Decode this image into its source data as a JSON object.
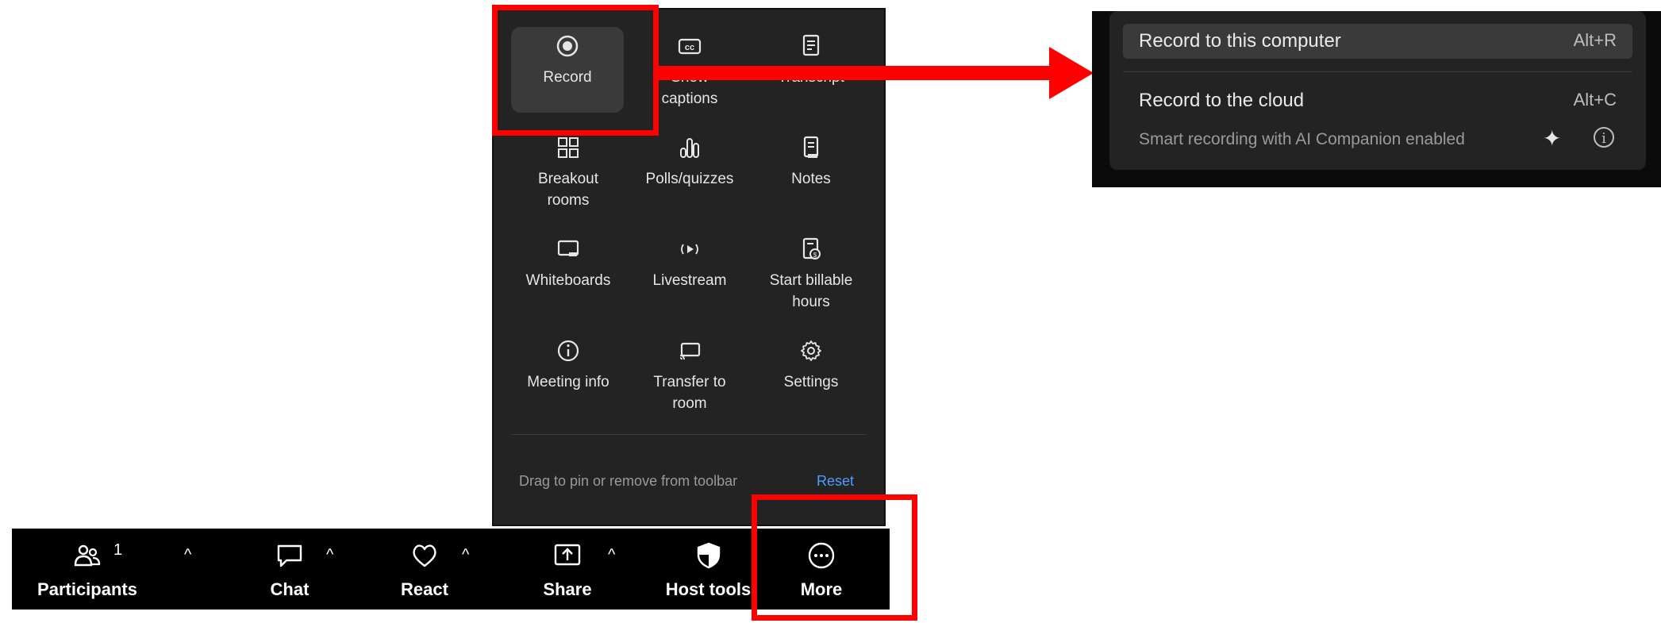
{
  "more_panel": {
    "tiles": [
      {
        "label": "Record",
        "icon": "record-icon"
      },
      {
        "label": "Show\ncaptions",
        "icon": "cc-icon"
      },
      {
        "label": "Transcript",
        "icon": "transcript-icon"
      },
      {
        "label": "Breakout\nrooms",
        "icon": "breakout-rooms-icon"
      },
      {
        "label": "Polls/quizzes",
        "icon": "polls-icon"
      },
      {
        "label": "Notes",
        "icon": "notes-icon"
      },
      {
        "label": "Whiteboards",
        "icon": "whiteboard-icon"
      },
      {
        "label": "Livestream",
        "icon": "livestream-icon"
      },
      {
        "label": "Start billable\nhours",
        "icon": "billable-hours-icon"
      },
      {
        "label": "Meeting info",
        "icon": "info-icon"
      },
      {
        "label": "Transfer to\nroom",
        "icon": "transfer-icon"
      },
      {
        "label": "Settings",
        "icon": "gear-icon"
      }
    ],
    "hint": "Drag to pin or remove from toolbar",
    "reset_label": "Reset"
  },
  "toolbar": {
    "items": [
      {
        "label": "Participants",
        "icon": "participants-icon",
        "count": "1"
      },
      {
        "label": "Chat",
        "icon": "chat-icon"
      },
      {
        "label": "React",
        "icon": "heart-icon"
      },
      {
        "label": "Share",
        "icon": "share-icon"
      },
      {
        "label": "Host tools",
        "icon": "shield-icon"
      },
      {
        "label": "More",
        "icon": "more-icon"
      }
    ]
  },
  "record_menu": {
    "items": [
      {
        "label": "Record to this computer",
        "shortcut": "Alt+R"
      },
      {
        "label": "Record to the cloud",
        "shortcut": "Alt+C"
      }
    ],
    "sub_text": "Smart recording with AI Companion enabled"
  },
  "colors": {
    "annotation": "#ff0000",
    "panel": "#232323",
    "link": "#4f9cff"
  }
}
